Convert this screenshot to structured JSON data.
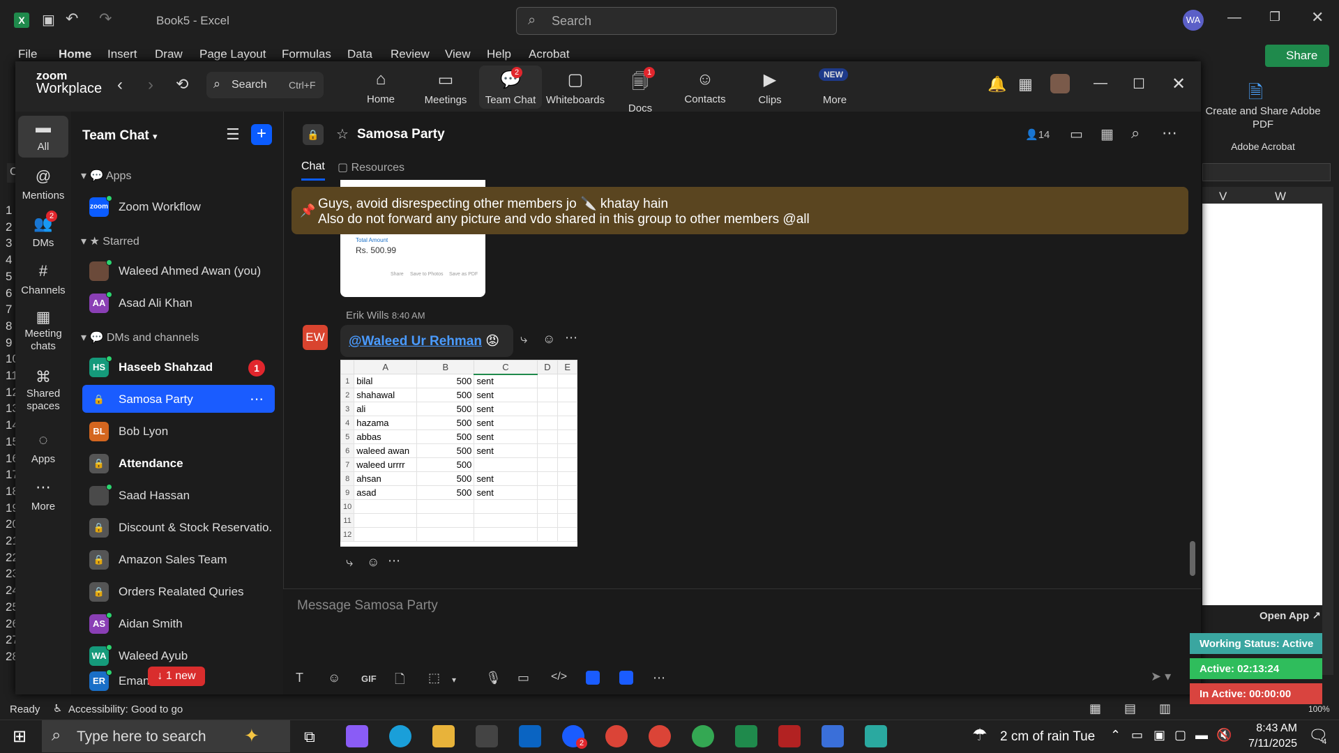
{
  "excel": {
    "doc_title": "Book5 - Excel",
    "search_placeholder": "Search",
    "user_initials": "WA",
    "menu": [
      "File",
      "Home",
      "Insert",
      "Draw",
      "Page Layout",
      "Formulas",
      "Data",
      "Review",
      "View",
      "Help",
      "Acrobat"
    ],
    "share_label": "Share",
    "acrobat_label": "Create and Share Adobe PDF",
    "acrobat_group": "Adobe Acrobat",
    "columns": [
      "V",
      "W"
    ],
    "row_numbers": [
      "1",
      "2",
      "3",
      "4",
      "5",
      "6",
      "7",
      "8",
      "9",
      "10",
      "11",
      "12",
      "13",
      "14",
      "15",
      "16",
      "17",
      "18",
      "19",
      "20",
      "21",
      "22",
      "23",
      "24",
      "25",
      "26",
      "27",
      "28"
    ],
    "status_ready": "Ready",
    "status_accessibility": "Accessibility: Good to go",
    "zoom_level": "100%"
  },
  "zoom": {
    "brand_line1": "zoom",
    "brand_line2": "Workplace",
    "search_label": "Search",
    "search_shortcut": "Ctrl+F",
    "nav": [
      {
        "label": "Home"
      },
      {
        "label": "Meetings"
      },
      {
        "label": "Team Chat",
        "badge": "2"
      },
      {
        "label": "Whiteboards"
      },
      {
        "label": "Docs",
        "badge": "1"
      },
      {
        "label": "Contacts"
      },
      {
        "label": "Clips"
      },
      {
        "label": "More",
        "tag": "NEW"
      }
    ],
    "rail": [
      {
        "label": "All"
      },
      {
        "label": "Mentions"
      },
      {
        "label": "DMs",
        "badge": "2"
      },
      {
        "label": "Channels"
      },
      {
        "label": "Meeting chats"
      },
      {
        "label": "Shared spaces"
      },
      {
        "label": "Apps"
      },
      {
        "label": "More"
      }
    ],
    "sidebar_title": "Team Chat",
    "sections": {
      "apps": "Apps",
      "starred": "Starred",
      "dms": "DMs and channels"
    },
    "app_items": [
      {
        "name": "Zoom Workflow",
        "av": "zoom"
      }
    ],
    "starred_items": [
      {
        "name": "Waleed Ahmed Awan (you)",
        "av": ""
      },
      {
        "name": "Asad Ali Khan",
        "av": "AA"
      }
    ],
    "dm_items": [
      {
        "name": "Haseeb Shahzad",
        "av": "HS",
        "badge": "1",
        "bold": true
      },
      {
        "name": "Samosa Party",
        "av": "",
        "active": true
      },
      {
        "name": "Bob Lyon",
        "av": "BL"
      },
      {
        "name": "Attendance",
        "av": "",
        "bold": true
      },
      {
        "name": "Saad Hassan",
        "av": ""
      },
      {
        "name": "Discount & Stock Reservatio...",
        "av": ""
      },
      {
        "name": "Amazon Sales Team",
        "av": ""
      },
      {
        "name": "Orders Realated Quries",
        "av": ""
      },
      {
        "name": "Aidan Smith",
        "av": "AS"
      },
      {
        "name": "Waleed Ayub",
        "av": "WA"
      },
      {
        "name": "Eman",
        "av": "ER"
      }
    ],
    "new_pill": "1 new",
    "channel": {
      "name": "Samosa Party",
      "members": "14",
      "tabs": [
        "Chat",
        "Resources"
      ]
    },
    "pinned": {
      "line1": "Guys, avoid disrespecting other members jo 🔪 khatay hain",
      "line2": "Also do not forward any picture and vdo shared in this group to other members @all"
    },
    "receipt": {
      "label": "Total Amount",
      "amount": "Rs. 500.99",
      "actions": [
        "Share",
        "Save to Photos",
        "Save as PDF"
      ]
    },
    "message": {
      "sender": "Erik Wills",
      "time": "8:40 AM",
      "avatar": "EW",
      "mention": "@Waleed Ur Rehman",
      "emoji": "😡"
    },
    "sheet": {
      "columns": [
        "",
        "A",
        "B",
        "C",
        "D",
        "E"
      ],
      "rows": [
        [
          "1",
          "bilal",
          "500",
          "sent"
        ],
        [
          "2",
          "shahawal",
          "500",
          "sent"
        ],
        [
          "3",
          "ali",
          "500",
          "sent"
        ],
        [
          "4",
          "hazama",
          "500",
          "sent"
        ],
        [
          "5",
          "abbas",
          "500",
          "sent"
        ],
        [
          "6",
          "waleed awan",
          "500",
          "sent"
        ],
        [
          "7",
          "waleed urrrr",
          "500",
          ""
        ],
        [
          "8",
          "ahsan",
          "500",
          "sent"
        ],
        [
          "9",
          "asad",
          "500",
          "sent"
        ],
        [
          "10",
          "",
          "",
          ""
        ],
        [
          "11",
          "",
          "",
          ""
        ],
        [
          "12",
          "",
          "",
          ""
        ]
      ]
    },
    "composer_placeholder": "Message Samosa Party",
    "gif_label": "GIF"
  },
  "widgets": {
    "open_app": "Open App",
    "working_status": "Working Status: Active",
    "active": "Active: 02:13:24",
    "inactive": "In Active: 00:00:00"
  },
  "taskbar": {
    "search_placeholder": "Type here to search",
    "weather": "2 cm of rain",
    "weather_day": "Tue",
    "time": "8:43 AM",
    "date": "7/11/2025",
    "notif_count": "4",
    "zoom_badge": "2"
  },
  "colors": {
    "accent": "#0b5cff",
    "active_row": "#1a5cff",
    "pin_bg": "#5a4520",
    "excel_green": "#1f8a4c"
  }
}
